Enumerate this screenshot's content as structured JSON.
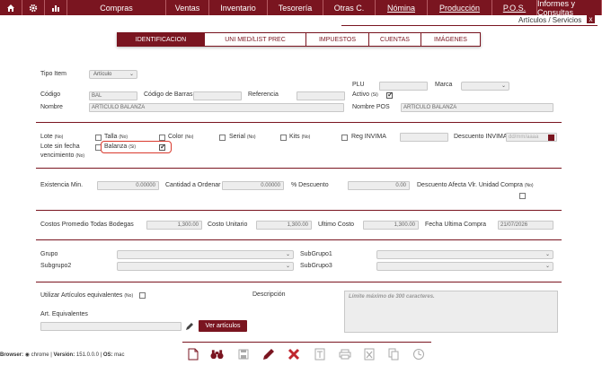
{
  "nav": {
    "home_icon": "home-icon",
    "settings_icon": "gear-icon",
    "reports_icon": "bar-chart-icon",
    "items": [
      {
        "label": "Compras"
      },
      {
        "label": "Ventas"
      },
      {
        "label": "Inventario"
      },
      {
        "label": "Tesorería"
      },
      {
        "label": "Otras C."
      },
      {
        "label": "Nómina"
      },
      {
        "label": "Producción"
      },
      {
        "label": "P.O.S."
      },
      {
        "label": "Informes y Consultas"
      }
    ]
  },
  "window": {
    "title": "Artículos / Servicios",
    "close": "x"
  },
  "tabs": [
    "IDENTIFICACION",
    "UNI MED/LIST PREC",
    "IMPUESTOS",
    "CUENTAS",
    "IMÁGENES"
  ],
  "ident": {
    "tipo_item_label": "Tipo Item",
    "tipo_item_value": "Artículo",
    "plu_label": "PLU",
    "marca_label": "Marca",
    "codigo_label": "Código",
    "codigo_value": "BAL",
    "codigo_barras_label": "Código de Barras",
    "referencia_label": "Referencia",
    "activo_label": "Activo",
    "activo_hint": "(Si)",
    "nombre_label": "Nombre",
    "nombre_value": "ARTICULO BALANZA",
    "nombre_pos_label": "Nombre POS",
    "nombre_pos_value": "ARTICULO BALANZA"
  },
  "flags": {
    "lote_label": "Lote",
    "lote_hint": "(No)",
    "talla_label": "Talla",
    "talla_hint": "(No)",
    "color_label": "Color",
    "color_hint": "(No)",
    "serial_label": "Serial",
    "serial_hint": "(No)",
    "kits_label": "Kits",
    "kits_hint": "(No)",
    "reg_invima_label": "Reg INVIMA",
    "desc_invima_label": "Descuento INVIMA",
    "date_placeholder": "dd/mm/aaaa",
    "lote_sin_fecha_label": "Lote sin fecha",
    "vencimiento_label": "vencimiento",
    "vencimiento_hint": "(No)",
    "balanza_label": "Balanza",
    "balanza_hint": "(Si)"
  },
  "stock": {
    "existencia_label": "Existencia Min.",
    "existencia_value": "0.00000",
    "cantidad_label": "Cantidad a Ordenar",
    "cantidad_value": "0.00000",
    "descuento_label": "% Descuento",
    "descuento_value": "0.00",
    "desc_afecta_label": "Descuento Afecta Vlr. Unidad Compra",
    "desc_afecta_hint": "(No)"
  },
  "costs": {
    "promedio_label": "Costos Promedio Todas Bodegas",
    "promedio_value": "1,300.00",
    "unitario_label": "Costo Unitario",
    "unitario_value": "1,300.00",
    "ultimo_label": "Ultimo Costo",
    "ultimo_value": "1,300.00",
    "fecha_label": "Fecha Ultima Compra",
    "fecha_value": "21/07/2026"
  },
  "groups": {
    "grupo_label": "Grupo",
    "subgrupo1_label": "SubGrupo1",
    "subgrupo2_label": "Subgrupo2",
    "subgrupo3_label": "SubGrupo3"
  },
  "equiv": {
    "utilizar_label": "Utilizar Artículos equivalentes",
    "utilizar_hint": "(No)",
    "descripcion_label": "Descripción",
    "descripcion_placeholder": "Límite máximo de 300 caracteres.",
    "art_equiv_label": "Art. Equivalentes",
    "ver_button": "Ver artículos"
  },
  "footer": {
    "browser_label": "Browser:",
    "browser_value": "chrome",
    "version_label": "Versión:",
    "version_value": "151.0.0.0",
    "os_label": "OS:",
    "os_value": "mac",
    "separator": "|"
  },
  "toolbar": [
    "new-document-icon",
    "search-binoculars-icon",
    "save-icon",
    "edit-pencil-icon",
    "delete-x-icon",
    "text-icon",
    "print-icon",
    "export-excel-icon",
    "copy-icon",
    "history-icon"
  ],
  "colors": {
    "brand": "#7a1520",
    "highlight": "#d93a2e"
  }
}
